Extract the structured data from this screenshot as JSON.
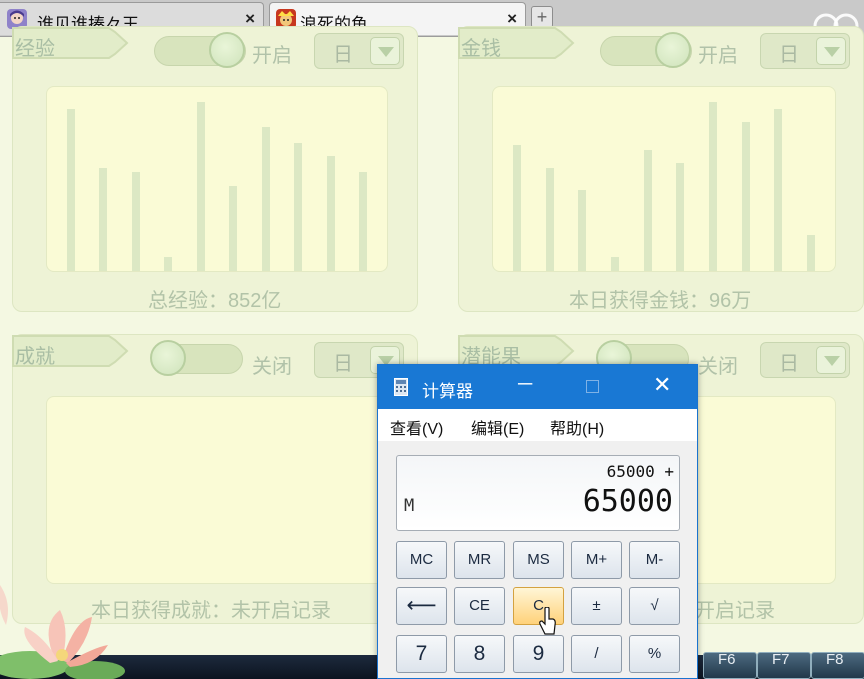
{
  "browser": {
    "tabs": [
      {
        "title": "谁见谁揍々王",
        "close": "×",
        "active": false
      },
      {
        "title": "浪死的鱼.",
        "close": "×",
        "active": true
      }
    ],
    "new_tab": "+"
  },
  "panels": [
    {
      "title": "经验",
      "toggle": "开启",
      "toggle_on": true,
      "period": "日",
      "caption": "总经验：852亿",
      "bars": [
        0.9,
        0.57,
        0.55,
        0.08,
        0.94,
        0.47,
        0.8,
        0.71,
        0.64,
        0.55
      ]
    },
    {
      "title": "金钱",
      "toggle": "开启",
      "toggle_on": true,
      "period": "日",
      "caption": "本日获得金钱：96万",
      "bars": [
        0.7,
        0.57,
        0.45,
        0.08,
        0.67,
        0.6,
        0.94,
        0.83,
        0.9,
        0.2
      ]
    },
    {
      "title": "成就",
      "toggle": "关闭",
      "toggle_on": false,
      "period": "日",
      "caption": "本日获得成就：未开启记录",
      "bars": []
    },
    {
      "title": "潜能果",
      "toggle": "关闭",
      "toggle_on": false,
      "period": "日",
      "caption": "本日获得潜能果：未开启记录",
      "bars": []
    }
  ],
  "hotkeys": [
    "F6",
    "F7",
    "F8"
  ],
  "calculator": {
    "title": "计算器",
    "min": "─",
    "close": "✕",
    "menu": [
      "查看(V)",
      "编辑(E)",
      "帮助(H)"
    ],
    "expression": "65000 +",
    "memory": "M",
    "value": "65000",
    "keys": [
      "MC",
      "MR",
      "MS",
      "M+",
      "M-",
      "⟵",
      "CE",
      "C",
      "±",
      "√",
      "7",
      "8",
      "9",
      "/",
      "%"
    ]
  },
  "colors": {
    "calc_title_bar": "#1978d4",
    "panel_bg": "#eef3d6",
    "chart_bg": "#fafbd6",
    "bar": "#dce8c4",
    "highlight_key": "#ffd27a"
  }
}
